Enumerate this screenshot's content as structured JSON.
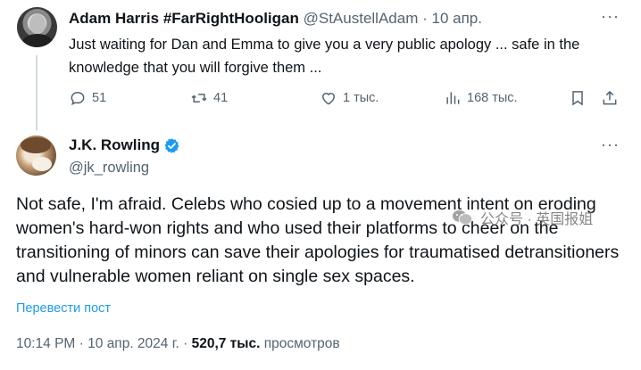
{
  "reply_tweet": {
    "display_name": "Adam Harris #FarRightHooligan",
    "handle": "@StAustellAdam",
    "separator": " · ",
    "date": "10 апр.",
    "text": "Just waiting for Dan and Emma to give you a very public apology ... safe in the knowledge that you will forgive them ...",
    "actions": {
      "replies": "51",
      "retweets": "41",
      "likes": "1 тыс.",
      "views": "168 тыс."
    },
    "more_icon": "more-horizontal-icon"
  },
  "main_tweet": {
    "display_name": "J.K. Rowling",
    "handle": "@jk_rowling",
    "verified": true,
    "text": "Not safe, I'm afraid. Celebs who cosied up to a movement intent on eroding women's hard-won rights and who used their platforms to cheer on the transitioning of minors can save their apologies for traumatised detransitioners and vulnerable women reliant on single sex spaces.",
    "translate_label": "Перевести пост",
    "time": "10:14 PM",
    "dot": " · ",
    "date": "10 апр. 2024 г.",
    "views_count": "520,7 тыс.",
    "views_label": "просмотров",
    "more_icon": "more-horizontal-icon"
  },
  "watermark": {
    "text": "公众号 · 英国报姐"
  },
  "colors": {
    "text_primary": "#0f1419",
    "text_secondary": "#536471",
    "link": "#1d9bf0",
    "verified_badge": "#1d9bf0",
    "thread_line": "#cfd9de"
  }
}
